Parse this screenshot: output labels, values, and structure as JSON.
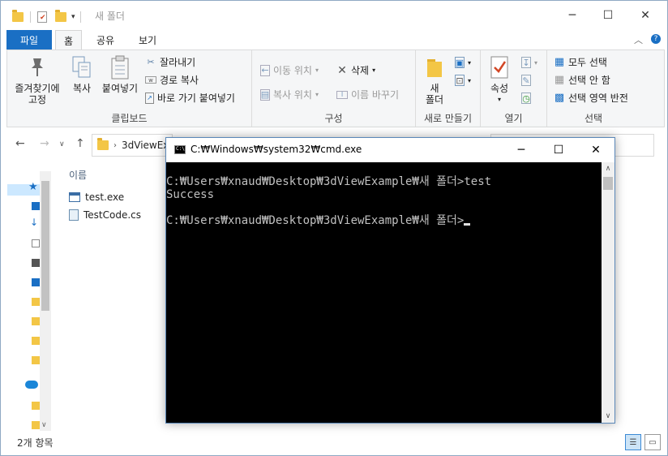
{
  "explorer": {
    "title": "새 폴더",
    "window_controls": {
      "minimize": "─",
      "maximize": "☐",
      "close": "✕"
    },
    "tabs": [
      {
        "label": "파일",
        "type": "file"
      },
      {
        "label": "홈",
        "active": true
      },
      {
        "label": "공유"
      },
      {
        "label": "보기"
      }
    ],
    "ribbon": {
      "clipboard": {
        "label": "클립보드",
        "pin_label_1": "즐겨찾기에",
        "pin_label_2": "고정",
        "copy": "복사",
        "paste": "붙여넣기",
        "cut": "잘라내기",
        "copy_path": "경로 복사",
        "paste_shortcut": "바로 가기 붙여넣기"
      },
      "organize": {
        "label": "구성",
        "move_to": "이동 위치",
        "copy_to": "복사 위치",
        "delete": "삭제",
        "rename": "이름 바꾸기"
      },
      "new": {
        "label": "새로 만들기",
        "new_folder_1": "새",
        "new_folder_2": "폴더"
      },
      "open": {
        "label": "열기",
        "properties": "속성"
      },
      "select": {
        "label": "선택",
        "select_all": "모두 선택",
        "select_none": "선택 안 함",
        "invert": "선택 영역 반전"
      }
    },
    "address": {
      "path_text": "3dViewEx"
    },
    "column_header": "이름",
    "files": [
      {
        "name": "test.exe",
        "icon": "exe-icon"
      },
      {
        "name": "TestCode.cs",
        "icon": "cs-file-icon"
      }
    ],
    "status": "2개 항목"
  },
  "cmd": {
    "title": "C:₩Windows₩system32₩cmd.exe",
    "icon_text": "C:\\",
    "lines": [
      "C:₩Users₩xnaud₩Desktop₩3dViewExample₩새 폴더>test",
      "Success",
      "",
      "C:₩Users₩xnaud₩Desktop₩3dViewExample₩새 폴더>"
    ]
  },
  "colors": {
    "accent": "#1a6fc4",
    "console_bg": "#000000",
    "console_text": "#c0c0c0"
  }
}
